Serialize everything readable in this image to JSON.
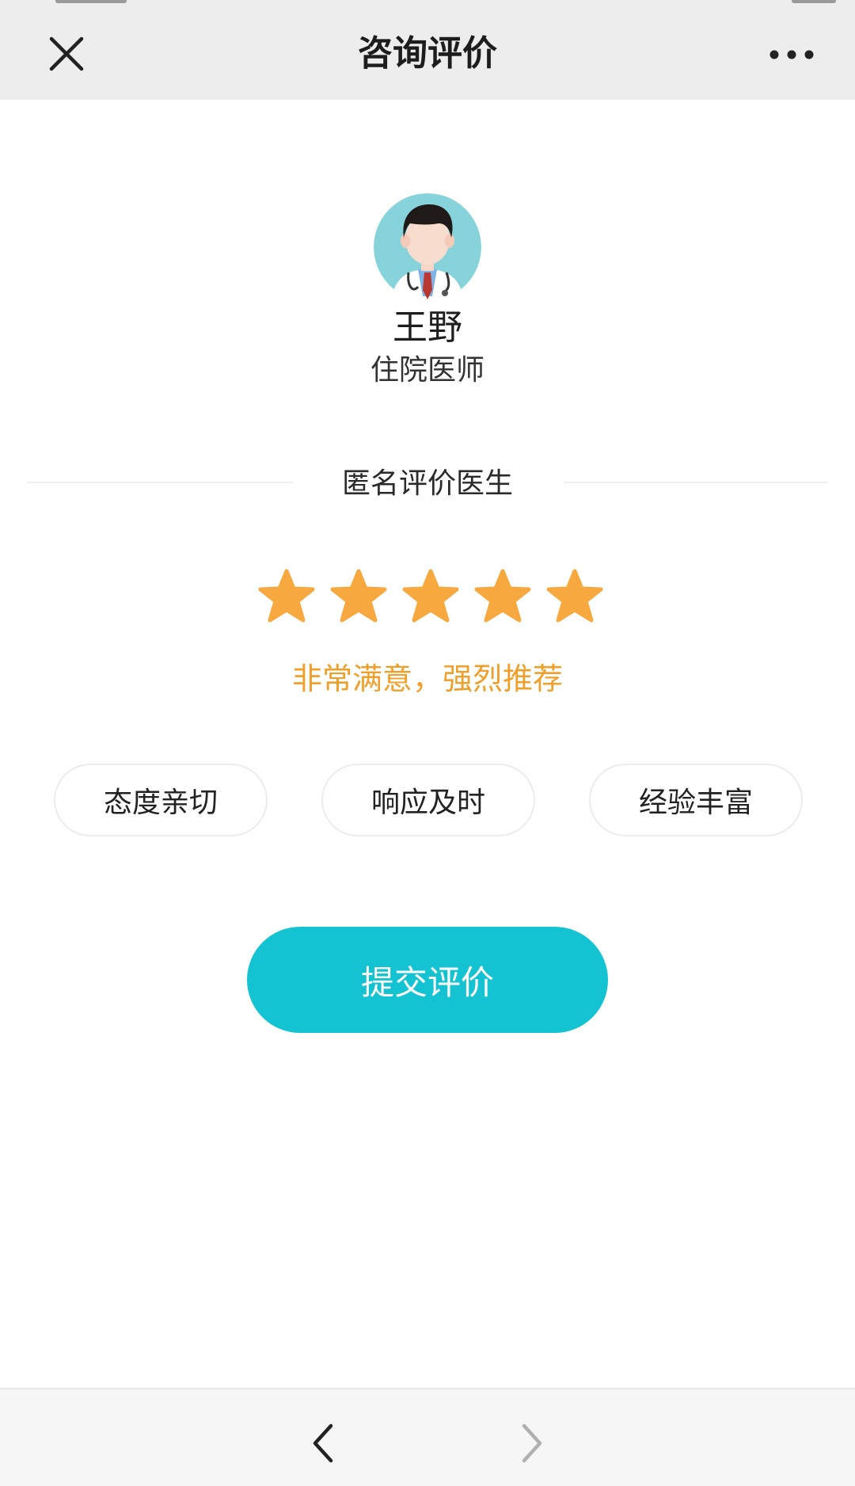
{
  "header": {
    "title": "咨询评价",
    "close_icon": "close-icon",
    "more_icon": "more-dots-icon"
  },
  "doctor": {
    "name": "王野",
    "title": "住院医师",
    "avatar_icon": "doctor-avatar-icon"
  },
  "review": {
    "section_title": "匿名评价医生",
    "rating": 5,
    "max_rating": 5,
    "rating_text": "非常满意，强烈推荐",
    "star_color": "#f7a940"
  },
  "tags": [
    {
      "label": "态度亲切"
    },
    {
      "label": "响应及时"
    },
    {
      "label": "经验丰富"
    }
  ],
  "actions": {
    "submit_label": "提交评价",
    "submit_color": "#14c3d1"
  },
  "toolbar": {
    "back_icon": "chevron-left-icon",
    "forward_icon": "chevron-right-icon"
  }
}
